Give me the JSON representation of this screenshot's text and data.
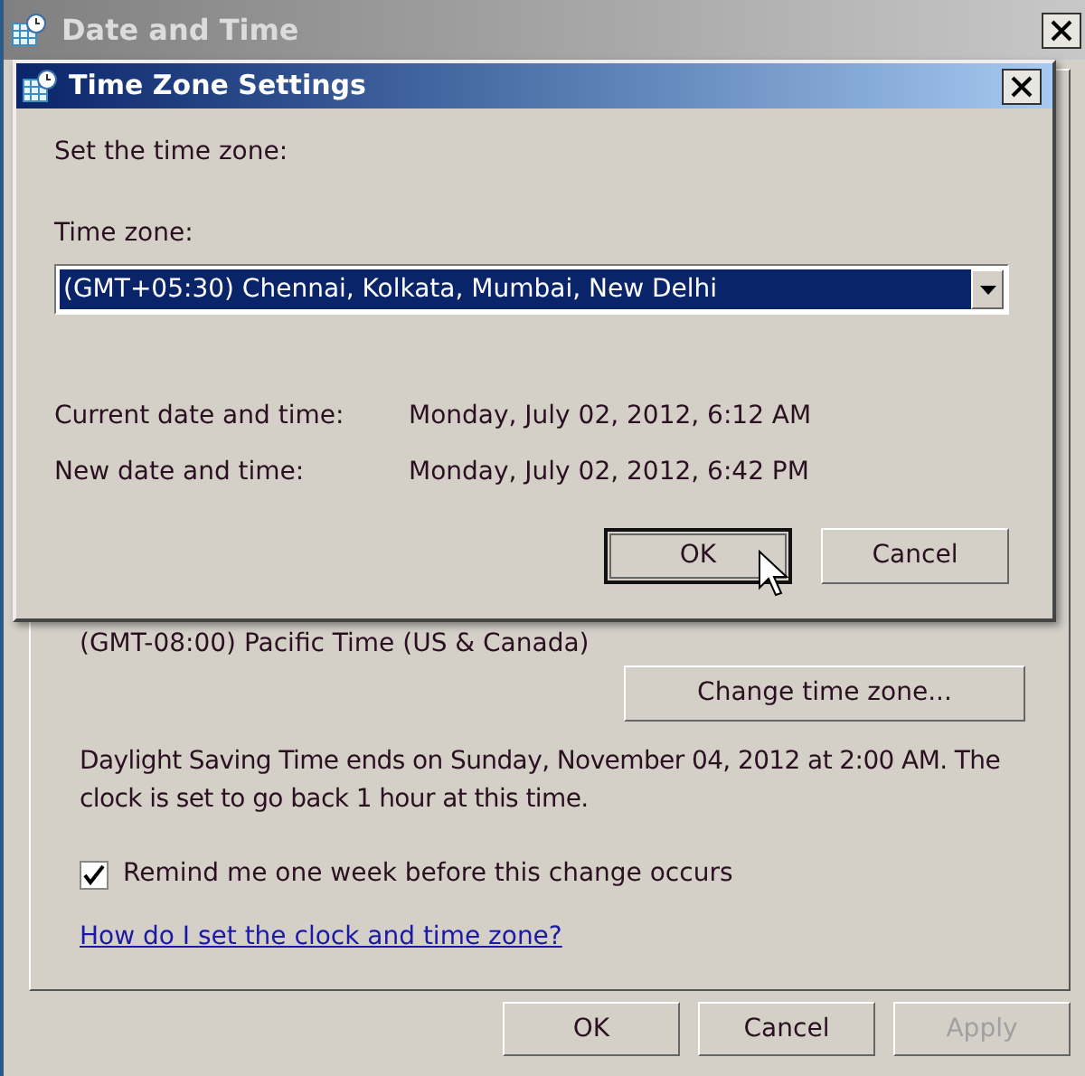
{
  "window": {
    "title": "Date and Time",
    "current_time_zone": "(GMT-08:00) Pacific Time (US & Canada)",
    "change_button": "Change time zone...",
    "dst_note": "Daylight Saving Time ends on Sunday, November 04, 2012 at 2:00 AM. The clock is set to go back 1 hour at this time.",
    "reminder": {
      "label": "Remind me one week before this change occurs",
      "checked": true
    },
    "help_link": "How do I set the clock and time zone?",
    "buttons": [
      {
        "label": "OK",
        "disabled": false
      },
      {
        "label": "Cancel",
        "disabled": false
      },
      {
        "label": "Apply",
        "disabled": true
      }
    ]
  },
  "dialog": {
    "title": "Time Zone Settings",
    "intro": "Set the time zone:",
    "time_zone_label": "Time zone:",
    "time_zone": "(GMT+05:30) Chennai, Kolkata, Mumbai, New Delhi",
    "rows": [
      {
        "label": "Current date and time:",
        "value": "Monday, July 02, 2012, 6:12 AM"
      },
      {
        "label": "New date and time:",
        "value": "Monday, July 02, 2012, 6:42 PM"
      }
    ],
    "buttons": [
      {
        "label": "OK",
        "default": true
      },
      {
        "label": "Cancel",
        "default": false
      }
    ]
  }
}
